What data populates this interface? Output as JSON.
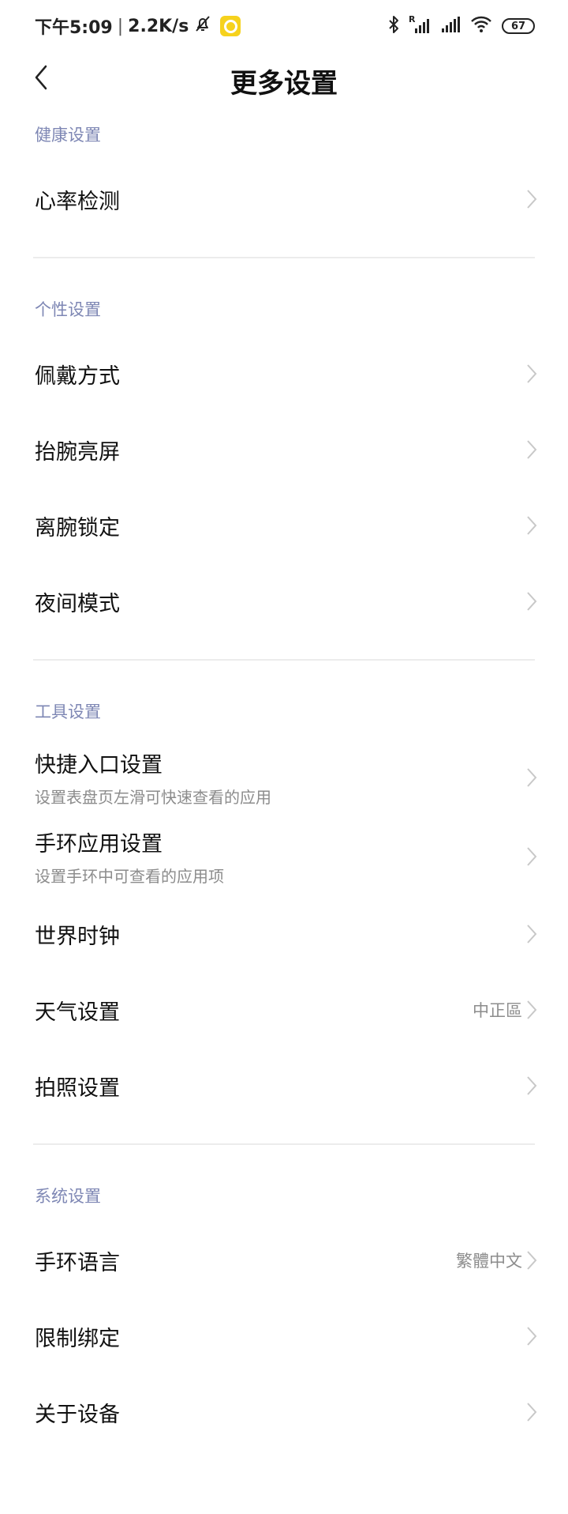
{
  "status_bar": {
    "time": "下午5:09",
    "separator": "|",
    "network_speed": "2.2K/s",
    "battery_level": "67",
    "icons": [
      "bell-off-icon",
      "app-notification-icon",
      "bluetooth-icon",
      "signal-roaming-icon",
      "signal-icon",
      "wifi-icon",
      "battery-icon"
    ]
  },
  "header": {
    "title": "更多设置",
    "back_icon": "chevron-left-icon"
  },
  "sections": {
    "health": {
      "header": "健康设置",
      "items": {
        "heart_rate": {
          "label": "心率检测"
        }
      }
    },
    "personal": {
      "header": "个性设置",
      "items": {
        "wear_mode": {
          "label": "佩戴方式"
        },
        "raise_wake": {
          "label": "抬腕亮屏"
        },
        "off_wrist_lock": {
          "label": "离腕锁定"
        },
        "night_mode": {
          "label": "夜间模式"
        }
      }
    },
    "tools": {
      "header": "工具设置",
      "items": {
        "shortcut": {
          "label": "快捷入口设置",
          "subtitle": "设置表盘页左滑可快速查看的应用"
        },
        "band_apps": {
          "label": "手环应用设置",
          "subtitle": "设置手环中可查看的应用项"
        },
        "world_clock": {
          "label": "世界时钟"
        },
        "weather": {
          "label": "天气设置",
          "value": "中正區"
        },
        "camera": {
          "label": "拍照设置"
        }
      }
    },
    "system": {
      "header": "系统设置",
      "items": {
        "language": {
          "label": "手环语言",
          "value": "繁體中文"
        },
        "restrict_binding": {
          "label": "限制绑定"
        },
        "about": {
          "label": "关于设备"
        }
      }
    }
  },
  "colors": {
    "section_header": "#7e87b4",
    "secondary_text": "#8c8c8c",
    "divider": "#ececec",
    "chevron": "#c8c8c8",
    "app_icon": "#f6d21d"
  }
}
